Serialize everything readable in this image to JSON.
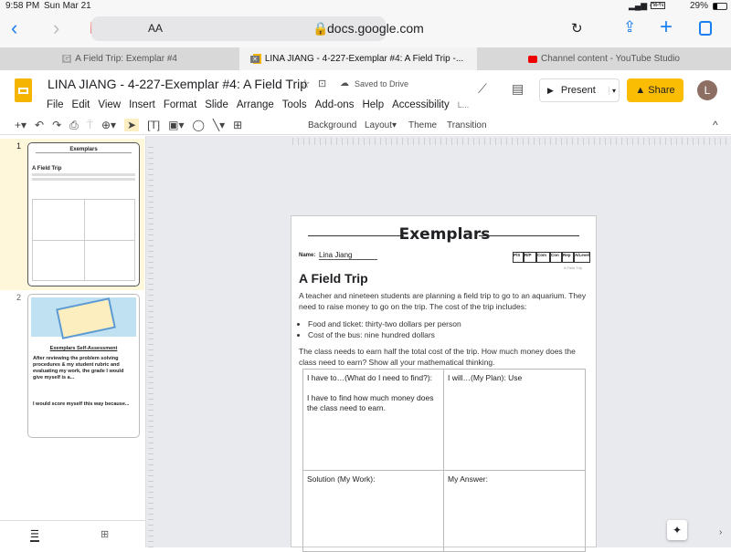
{
  "status_bar": {
    "time": "9:58 PM",
    "date": "Sun Mar 21",
    "battery": "29%",
    "vpn": "VPN"
  },
  "safari": {
    "text_size": "AA",
    "url": "docs.google.com"
  },
  "tabs": [
    {
      "label": "A Field Trip: Exemplar #4",
      "favicon": "G"
    },
    {
      "label": "LINA JIANG - 4-227-Exemplar #4: A Field Trip -...",
      "active": true
    },
    {
      "label": "Channel content - YouTube Studio"
    }
  ],
  "doc": {
    "title": "LINA JIANG - 4-227-Exemplar #4: A Field Trip",
    "saved": "Saved to Drive",
    "present": "Present",
    "share": "Share",
    "avatar": "L",
    "menu": [
      "File",
      "Edit",
      "View",
      "Insert",
      "Format",
      "Slide",
      "Arrange",
      "Tools",
      "Add-ons",
      "Help",
      "Accessibility",
      "L..."
    ]
  },
  "toolbar": {
    "background": "Background",
    "layout": "Layout",
    "theme": "Theme",
    "transition": "Transition"
  },
  "slides": [
    {
      "number": "1",
      "title": "Exemplars",
      "subtitle": "A Field Trip"
    },
    {
      "number": "2",
      "heading": "Exemplars Self-Assessment",
      "text1": "After reviewing the problem solving procedures & my student rubric and evaluating my work, the grade I would give myself is a...",
      "text2": "I would score myself this way because..."
    }
  ],
  "page": {
    "banner": "Exemplars",
    "name_label": "Name:",
    "name_value": "Lina Jiang",
    "rubric": [
      "P/S",
      "R/P",
      "Com",
      "Con",
      "Rep",
      "A/Level"
    ],
    "rubric_note": "A Field Trip",
    "title": "A Field Trip",
    "intro": "A teacher and nineteen students are planning a field trip to go to an aquarium. They need to raise money to go on the trip. The cost of the trip includes:",
    "bullets": [
      "Food and ticket: thirty-two dollars per person",
      "Cost of the bus: nine hundred dollars"
    ],
    "question": "The class needs to earn half the total cost of the trip. How much money does the class need to earn? Show all your mathematical thinking.",
    "cells": {
      "find_label": "I have to…(What do I need to find?):",
      "find_answer": "I have to find how much money does the class need to earn.",
      "plan": "I will…(My Plan): Use",
      "solution": "Solution (My Work):",
      "answer": "My Answer:"
    }
  },
  "colors": {
    "accent": "#fbbc04",
    "safari_blue": "#1a7ff0",
    "slides_yellow": "#f4b400"
  }
}
